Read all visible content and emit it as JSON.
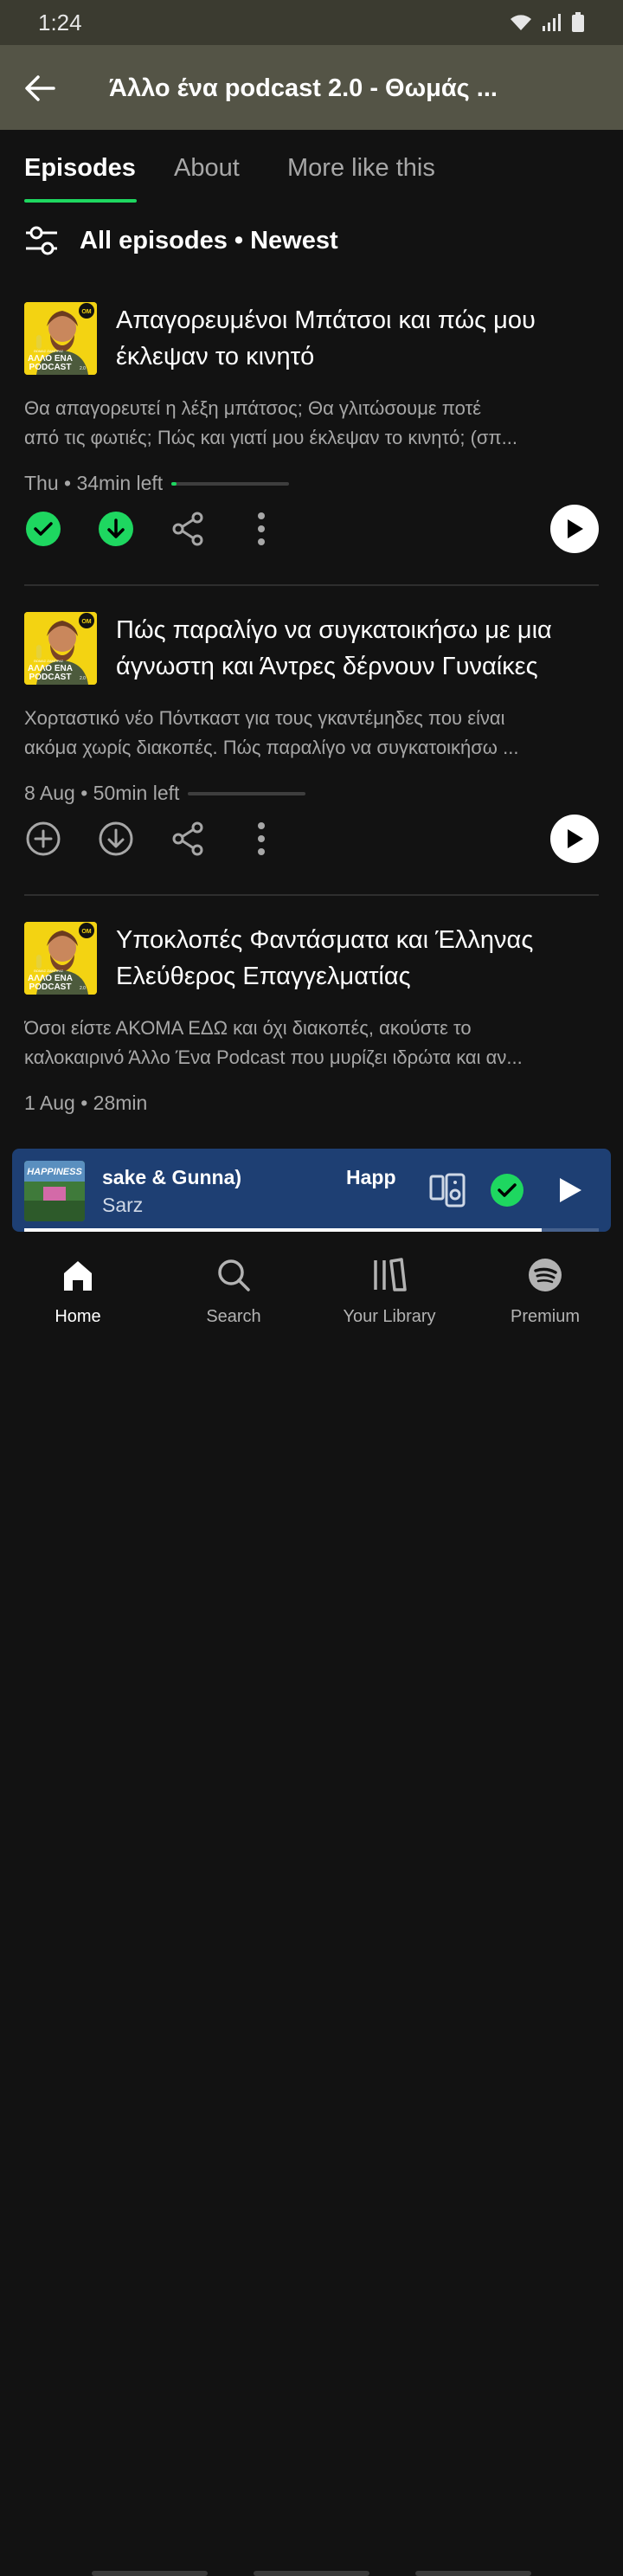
{
  "status_bar": {
    "time": "1:24"
  },
  "header": {
    "title": "Άλλο ένα podcast 2.0 - Θωμάς ..."
  },
  "tabs": [
    {
      "label": "Episodes",
      "active": true
    },
    {
      "label": "About",
      "active": false
    },
    {
      "label": "More like this",
      "active": false
    }
  ],
  "filter": {
    "label": "All episodes • Newest"
  },
  "episodes": [
    {
      "title_lines": [
        "Απαγορευμένοι Μπάτσοι και πώς μου",
        "έκλεψαν το κινητό"
      ],
      "desc_lines": [
        "Θα απαγορευτεί η λέξη μπάτσος; Θα γλιτώσουμε ποτέ",
        "από τις φωτιές; Πώς και γιατί μου έκλεψαν το κινητό; (σπ..."
      ],
      "meta": "Thu • 34min left",
      "progress": 0.04,
      "added": true,
      "downloaded": true
    },
    {
      "title_lines": [
        "Πώς παραλίγο να συγκατοικήσω με μια",
        "άγνωστη και Άντρες δέρνουν Γυναίκες"
      ],
      "desc_lines": [
        "Χορταστικό νέο Πόντκαστ για τους γκαντέμηδες που είναι",
        "ακόμα χωρίς διακοπές. Πώς παραλίγο να συγκατοικήσω ..."
      ],
      "meta": "8 Aug • 50min left",
      "progress": 0.0,
      "added": false,
      "downloaded": false
    },
    {
      "title_lines": [
        "Υποκλοπές Φαντάσματα και Έλληνας",
        "Ελεύθερος Επαγγελματίας"
      ],
      "desc_lines": [
        "Όσοι είστε ΑΚΟΜΑ ΕΔΩ και όχι διακοπές, ακούστε το",
        "καλοκαιρινό Άλλο Ένα Podcast που μυρίζει ιδρώτα και αν..."
      ],
      "meta": "1 Aug • 28min"
    }
  ],
  "thumb_text": {
    "top": "ΘΩΜΑΣ ΖΑΜΠΡΑΣ",
    "line1": "ΑΛΛΟ ΕΝΑ",
    "line2": "PODCAST",
    "ver": "2.0",
    "badge": "OM"
  },
  "mini_player": {
    "track": "sake & Gunna)",
    "track_next": "Happ",
    "artist": "Sarz",
    "art_text": "HAPPINESS",
    "progress": 0.9
  },
  "nav": [
    {
      "label": "Home",
      "icon": "home-icon",
      "active": true
    },
    {
      "label": "Search",
      "icon": "search-icon",
      "active": false
    },
    {
      "label": "Your Library",
      "icon": "library-icon",
      "active": false
    },
    {
      "label": "Premium",
      "icon": "spotify-icon",
      "active": false
    }
  ],
  "colors": {
    "accent": "#1ed760",
    "mini_player_bg": "#1e3f73",
    "header_bg": "#545446"
  }
}
